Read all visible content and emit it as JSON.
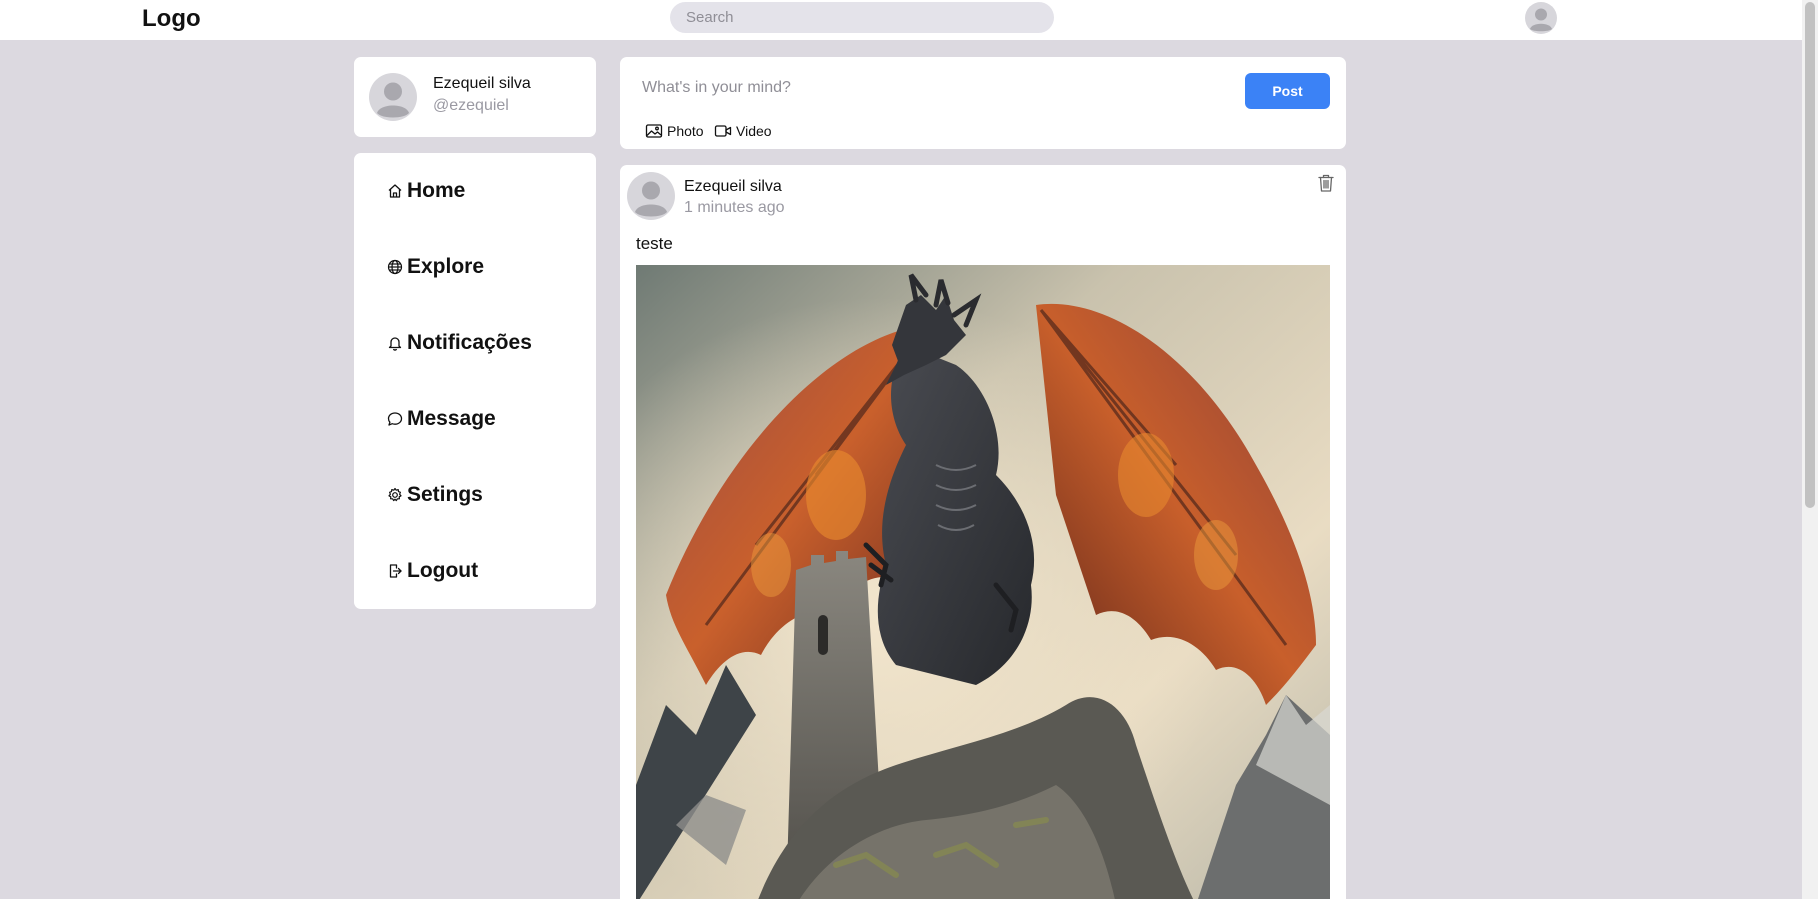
{
  "header": {
    "logo": "Logo",
    "search_placeholder": "Search"
  },
  "profile": {
    "name": "Ezequeil silva",
    "handle": "@ezequiel"
  },
  "nav": {
    "items": [
      {
        "label": "Home",
        "icon": "home-icon"
      },
      {
        "label": "Explore",
        "icon": "globe-icon"
      },
      {
        "label": "Notificações",
        "icon": "bell-icon"
      },
      {
        "label": "Message",
        "icon": "chat-icon"
      },
      {
        "label": "Setings",
        "icon": "gear-icon"
      },
      {
        "label": "Logout",
        "icon": "logout-icon"
      }
    ]
  },
  "compose": {
    "placeholder": "What's in your mind?",
    "post_label": "Post",
    "photo_label": "Photo",
    "video_label": "Video"
  },
  "post": {
    "author": "Ezequeil silva",
    "time": "1 minutes ago",
    "text": "teste"
  },
  "colors": {
    "background": "#dcd9e0",
    "accent": "#3b82f6",
    "muted_text": "#9a99a2"
  }
}
